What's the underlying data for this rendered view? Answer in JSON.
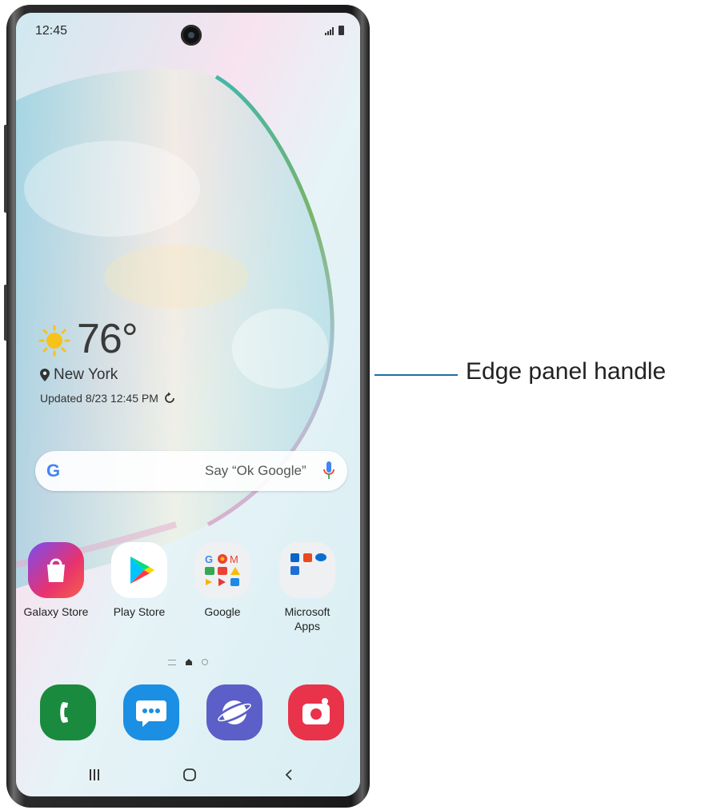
{
  "status_bar": {
    "time": "12:45"
  },
  "weather": {
    "temperature": "76°",
    "location": "New York",
    "updated": "Updated 8/23 12:45 PM"
  },
  "search": {
    "placeholder": "Say “Ok Google”",
    "logo": "G"
  },
  "apps": [
    {
      "label": "Galaxy Store",
      "icon": "galaxy-store-icon"
    },
    {
      "label": "Play Store",
      "icon": "play-store-icon"
    },
    {
      "label": "Google",
      "icon": "google-folder-icon"
    },
    {
      "label": "Microsoft\nApps",
      "icon": "microsoft-folder-icon"
    }
  ],
  "dock": [
    {
      "icon": "phone-icon"
    },
    {
      "icon": "messages-icon"
    },
    {
      "icon": "internet-icon"
    },
    {
      "icon": "camera-icon"
    }
  ],
  "nav": {
    "recents": "III",
    "home": "O",
    "back": "<"
  },
  "callout": {
    "label": "Edge panel handle"
  },
  "colors": {
    "callout_line": "#1c6ea4",
    "edge_handle": "#7c8aa1"
  }
}
